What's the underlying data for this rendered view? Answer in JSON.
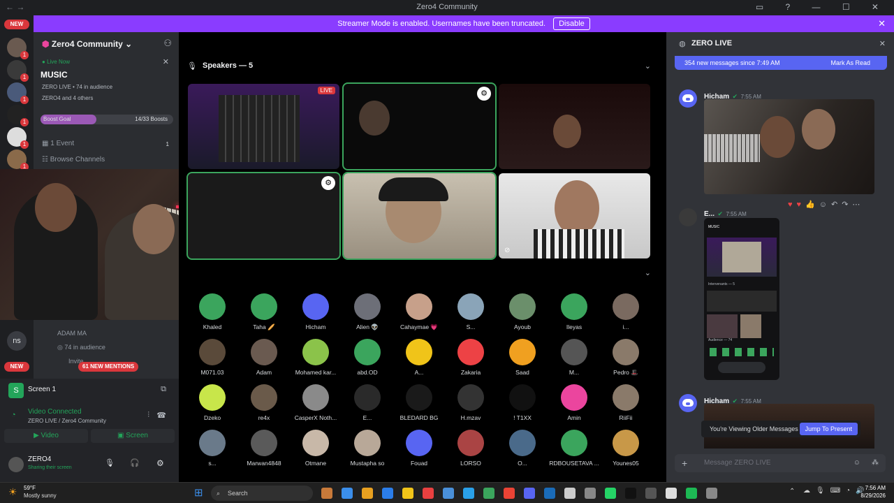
{
  "window": {
    "title": "Zero4 Community"
  },
  "banner": {
    "text": "Streamer Mode is enabled. Usernames have been truncated.",
    "disable": "Disable"
  },
  "rail": {
    "new_top": "NEW",
    "new_bottom": "NEW",
    "ns": "ns",
    "badge": "1"
  },
  "sidebar": {
    "server_name": "Zero4 Community",
    "live_now": "Live Now",
    "channel": "MUSIC",
    "live_meta": "ZERO LIVE • 74 in audience",
    "live_people": "ZERO4 and 4 others",
    "boost_label": "Boost Goal",
    "boost_count": "14/33 Boosts",
    "boost_fraction": 0.42,
    "event_label": "1 Event",
    "event_count": "1",
    "browse_channels": "Browse Channels",
    "adam_row": "ADAM MA",
    "audience_row": "74 in audience",
    "invite_row": "Invite",
    "mentions_pill": "61 NEW MENTIONS"
  },
  "voice_panel": {
    "screen_label": "Screen 1",
    "status": "Video Connected",
    "location": "ZERO LIVE / Zero4 Community",
    "video_btn": "Video",
    "screen_btn": "Screen",
    "username": "ZERO4",
    "user_status": "Sharing their screen"
  },
  "stage": {
    "speakers_header": "Speakers — 5",
    "live_tag": "LIVE",
    "audience": [
      {
        "name": "Khaled",
        "color": "#3ba55d"
      },
      {
        "name": "Taha 🥖",
        "color": "#3ba55d"
      },
      {
        "name": "Hicham",
        "color": "#5865f2"
      },
      {
        "name": "Alien 👽",
        "color": "#6d6f78"
      },
      {
        "name": "Cahaymae 💗",
        "color": "#c7a08a"
      },
      {
        "name": "S...",
        "color": "#8aa4b8"
      },
      {
        "name": "Ayoub",
        "color": "#6b8f6b"
      },
      {
        "name": "Ileyas",
        "color": "#3ba55d"
      },
      {
        "name": "i...",
        "color": "#7a6a60"
      },
      {
        "name": "M071.03",
        "color": "#5a4a3a"
      },
      {
        "name": "Adam",
        "color": "#6a5a50"
      },
      {
        "name": "Mohamed kar...",
        "color": "#8bc34a"
      },
      {
        "name": "abd.OD",
        "color": "#3ba55d"
      },
      {
        "name": "A...",
        "color": "#f0c419"
      },
      {
        "name": "Zakaria",
        "color": "#ed4245"
      },
      {
        "name": "Saad",
        "color": "#f0a020"
      },
      {
        "name": "M...",
        "color": "#555555"
      },
      {
        "name": "Pedro 🎩",
        "color": "#8a7a6a"
      },
      {
        "name": "Dzeko",
        "color": "#c8e64a"
      },
      {
        "name": "re4x",
        "color": "#6a5a4a"
      },
      {
        "name": "CasperX Noth...",
        "color": "#8a8a8a"
      },
      {
        "name": "E...",
        "color": "#2a2a2a"
      },
      {
        "name": "BLEDARD BG",
        "color": "#1a1a1a"
      },
      {
        "name": "H.mzav",
        "color": "#333333"
      },
      {
        "name": "! T1XX",
        "color": "#111111"
      },
      {
        "name": "Amin",
        "color": "#eb459e"
      },
      {
        "name": "RiiFii",
        "color": "#8a7a6a"
      },
      {
        "name": "s...",
        "color": "#6a7a8a"
      },
      {
        "name": "Marwan4848",
        "color": "#5a5a5a"
      },
      {
        "name": "Otmane",
        "color": "#c8b8a8"
      },
      {
        "name": "Mustapha so",
        "color": "#b8a898"
      },
      {
        "name": "Fouad",
        "color": "#5865f2"
      },
      {
        "name": "LORSO",
        "color": "#aa4444"
      },
      {
        "name": "O...",
        "color": "#4a6a8a"
      },
      {
        "name": "RDBOUSETAVA ...",
        "color": "#3ba55d"
      },
      {
        "name": "Younes05",
        "color": "#c89848"
      }
    ]
  },
  "chat": {
    "channel": "ZERO LIVE",
    "new_messages": "354 new messages since 7:49 AM",
    "mark_read": "Mark As Read",
    "msg1_user": "Hicham",
    "msg1_time": "7:55 AM",
    "msg2_user": "E...",
    "msg2_time": "7:55 AM",
    "msg3_user": "Hicham",
    "msg3_time": "7:55 AM",
    "phone_music": "MUSIC",
    "phone_speakers": "Intervenants — 5",
    "phone_audience": "Audience — 74",
    "older_text": "You're Viewing Older Messages",
    "jump_btn": "Jump To Present",
    "placeholder": "Message ZERO LIVE"
  },
  "taskbar": {
    "temp": "59°F",
    "weather": "Mostly sunny",
    "search": "Search",
    "time": "7:56 AM",
    "date": "8/29/2026"
  }
}
